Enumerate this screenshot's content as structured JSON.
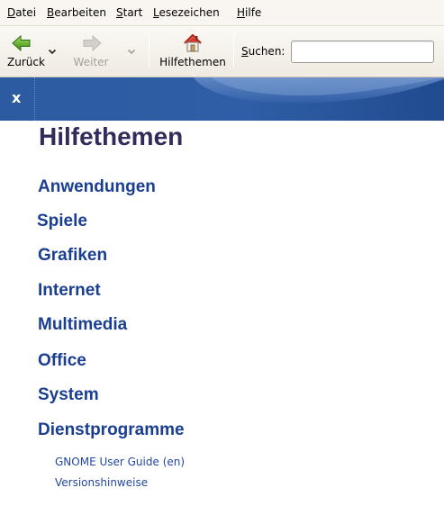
{
  "menubar": {
    "items": [
      {
        "key": "D",
        "rest": "atei"
      },
      {
        "key": "B",
        "rest": "earbeiten"
      },
      {
        "key": "S",
        "rest": "tart"
      },
      {
        "key": "L",
        "rest": "esezeichen"
      },
      {
        "key": "H",
        "rest": "ilfe"
      }
    ]
  },
  "toolbar": {
    "back_label": "Zurück",
    "forward_label": "Weiter",
    "topics_label": "Hilfethemen",
    "search_key": "S",
    "search_rest": "uchen:",
    "search_value": "",
    "icons": {
      "back": "back-arrow-icon",
      "forward": "forward-arrow-icon",
      "home": "home-icon"
    },
    "colors": {
      "back_arrow": "#4a9a1e",
      "forward_arrow_disabled": "#bdbab4",
      "home_roof": "#cc2b1d"
    }
  },
  "header": {
    "close_symbol": "x",
    "background_color": "#2c5aa0"
  },
  "content": {
    "title": "Hilfethemen",
    "topics": [
      "Anwendungen",
      "Spiele",
      "Grafiken",
      "Internet",
      "Multimedia",
      "Office",
      "System",
      "Dienstprogramme"
    ],
    "links": [
      "GNOME User Guide (en)",
      "Versionshinweise"
    ],
    "topic_color": "#1a3f91",
    "title_color": "#322c5a"
  }
}
